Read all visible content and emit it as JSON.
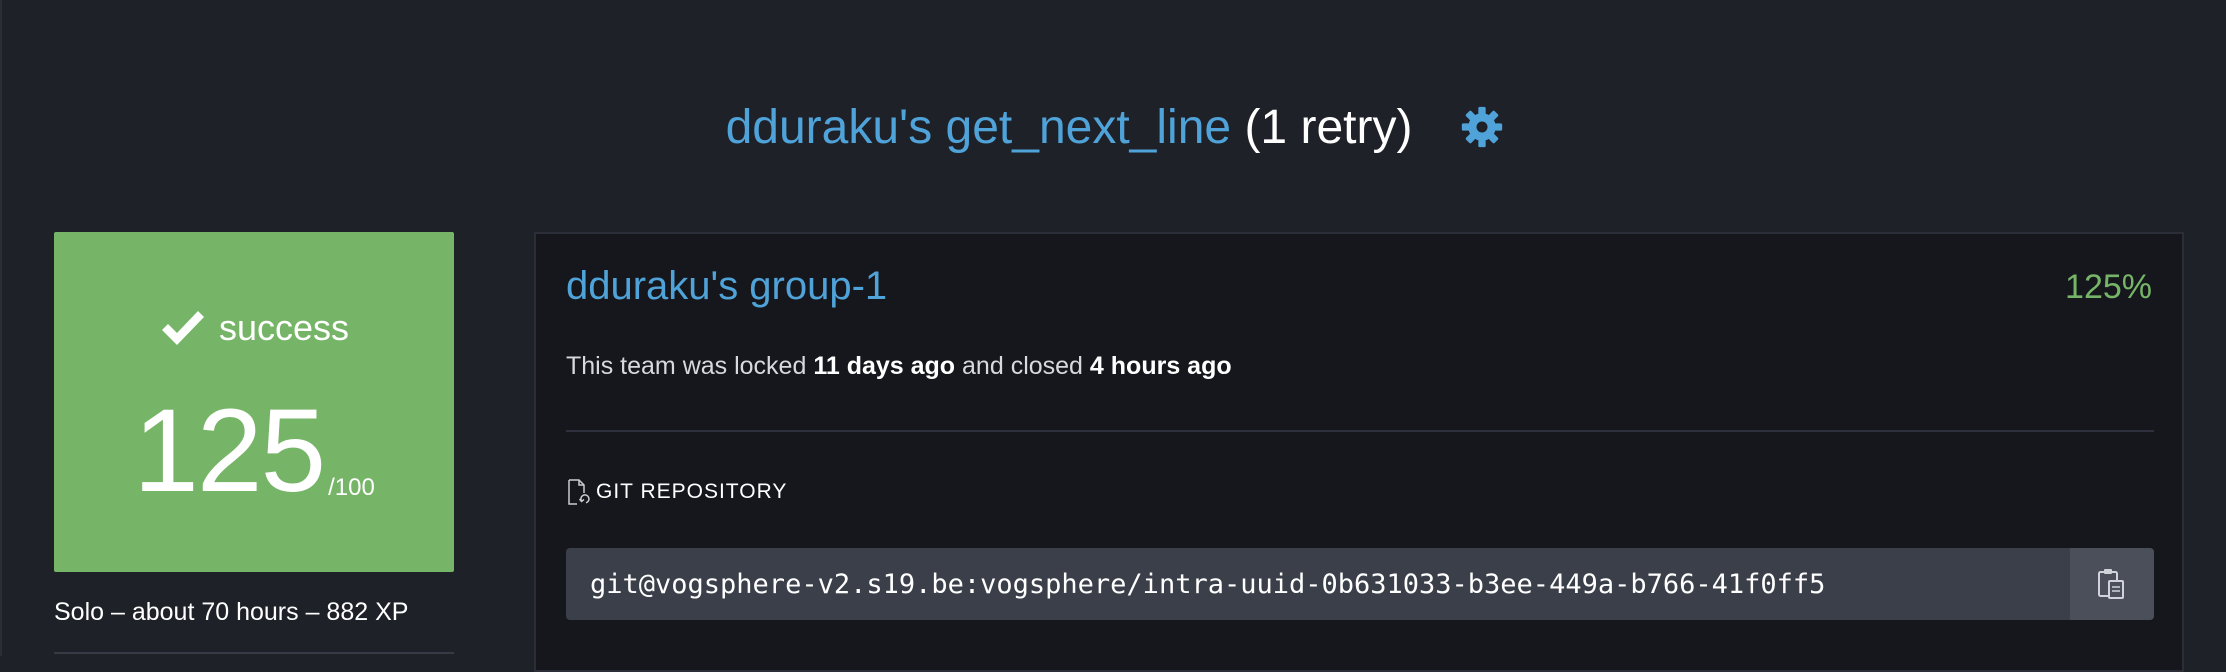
{
  "header": {
    "title_project": "dduraku's get_next_line",
    "title_retry": "(1 retry)",
    "settings_icon": "gear-icon",
    "accent_color": "#4fa3d9"
  },
  "result": {
    "status_icon": "check-icon",
    "status": "success",
    "score": "125",
    "max_score": "/100",
    "meta": "Solo – about 70 hours – 882 XP",
    "color": "#76b567"
  },
  "team": {
    "name": "dduraku's group-1",
    "grade": "125%",
    "lock_prefix": "This team was locked",
    "locked_ago": "11 days ago",
    "closed_prefix": "and closed",
    "closed_ago": "4 hours ago",
    "repo_label": "GIT REPOSITORY",
    "repo_icon": "repository-icon",
    "repo_url": "git@vogsphere-v2.s19.be:vogsphere/intra-uuid-0b631033-b3ee-449a-b766-41f0ff5",
    "copy_icon": "clipboard-icon"
  }
}
